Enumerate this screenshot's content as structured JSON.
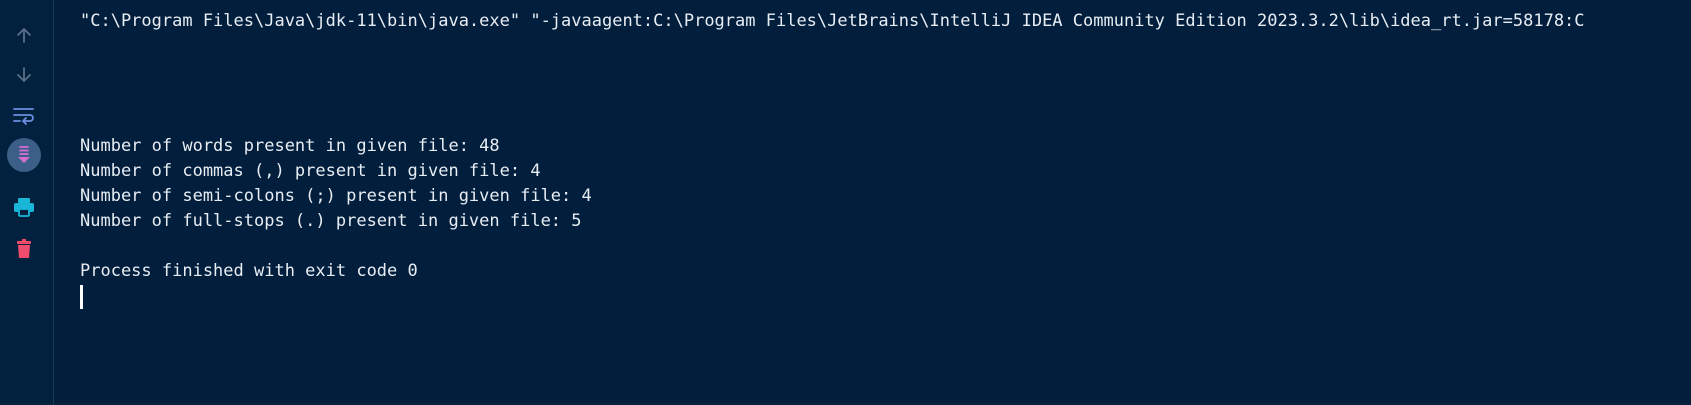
{
  "toolbar": {
    "buttons": [
      {
        "name": "up-arrow-icon",
        "label": "Up the stack trace"
      },
      {
        "name": "down-arrow-icon",
        "label": "Down the stack trace"
      },
      {
        "name": "soft-wrap-icon",
        "label": "Soft-wrap"
      },
      {
        "name": "scroll-to-end-icon",
        "label": "Scroll to end",
        "active": true
      },
      {
        "name": "print-icon",
        "label": "Print"
      },
      {
        "name": "trash-icon",
        "label": "Clear all"
      }
    ]
  },
  "console": {
    "command": "\"C:\\Program Files\\Java\\jdk-11\\bin\\java.exe\" \"-javaagent:C:\\Program Files\\JetBrains\\IntelliJ IDEA Community Edition 2023.3.2\\lib\\idea_rt.jar=58178:C",
    "output": [
      "Number of words present in given file: 48",
      "Number of commas (,) present in given file: 4",
      "Number of semi-colons (;) present in given file: 4",
      "Number of full-stops (.) present in given file: 5"
    ],
    "exit_message": "Process finished with exit code 0"
  },
  "colors": {
    "background": "#011e3d",
    "text": "#e8edf3",
    "icon_muted": "#5a6f86",
    "icon_blue": "#6b8fe0",
    "icon_cyan": "#18b7d8",
    "icon_pink": "#d36fd3",
    "icon_red": "#ef4c6b"
  }
}
